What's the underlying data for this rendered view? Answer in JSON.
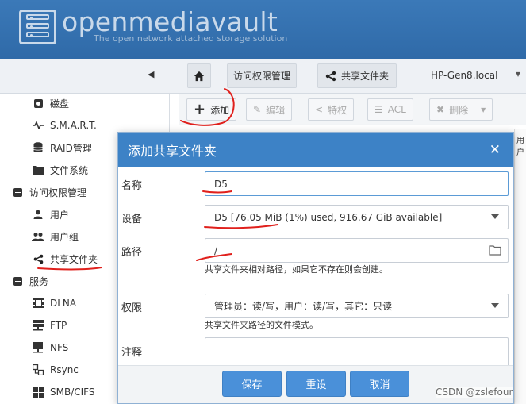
{
  "header": {
    "brand": "openmediavault",
    "tagline": "The open network attached storage solution"
  },
  "topnav": {
    "breadcrumbs": [
      "访问权限管理",
      "共享文件夹"
    ],
    "hostname": "HP-Gen8.local"
  },
  "sidebar": {
    "items": [
      {
        "label": "磁盘",
        "icon": "disk-icon"
      },
      {
        "label": "S.M.A.R.T.",
        "icon": "pulse-icon"
      },
      {
        "label": "RAID管理",
        "icon": "database-icon"
      },
      {
        "label": "文件系统",
        "icon": "folder-icon"
      },
      {
        "label": "访问权限管理",
        "icon": "collapse-icon"
      },
      {
        "label": "用户",
        "icon": "user-icon"
      },
      {
        "label": "用户组",
        "icon": "users-icon"
      },
      {
        "label": "共享文件夹",
        "icon": "share-icon"
      },
      {
        "label": "服务",
        "icon": "collapse-icon"
      },
      {
        "label": "DLNA",
        "icon": "film-icon"
      },
      {
        "label": "FTP",
        "icon": "server-icon"
      },
      {
        "label": "NFS",
        "icon": "storage-icon"
      },
      {
        "label": "Rsync",
        "icon": "sync-icon"
      },
      {
        "label": "SMB/CIFS",
        "icon": "windows-icon"
      }
    ]
  },
  "toolbar": {
    "add": "添加",
    "edit": "编辑",
    "privileges": "特权",
    "acl": "ACL",
    "delete": "删除"
  },
  "grid_edge_text": "用户",
  "dialog": {
    "title": "添加共享文件夹",
    "name_label": "名称",
    "name_value": "D5",
    "device_label": "设备",
    "device_value": "D5 [76.05 MiB (1%) used, 916.67 GiB available]",
    "path_label": "路径",
    "path_value": "/",
    "path_hint": "共享文件夹相对路径，如果它不存在则会创建。",
    "permission_label": "权限",
    "permission_value": "管理员：读/写，用户：读/写，其它：只读",
    "permission_hint": "共享文件夹路径的文件模式。",
    "comment_label": "注释",
    "save": "保存",
    "reset": "重设",
    "cancel": "取消"
  },
  "watermark": "CSDN @zslefour",
  "colors": {
    "header": "#3472b2",
    "dialog_title": "#3d82c6",
    "button": "#4a90d9",
    "annotation": "#e0201c"
  }
}
